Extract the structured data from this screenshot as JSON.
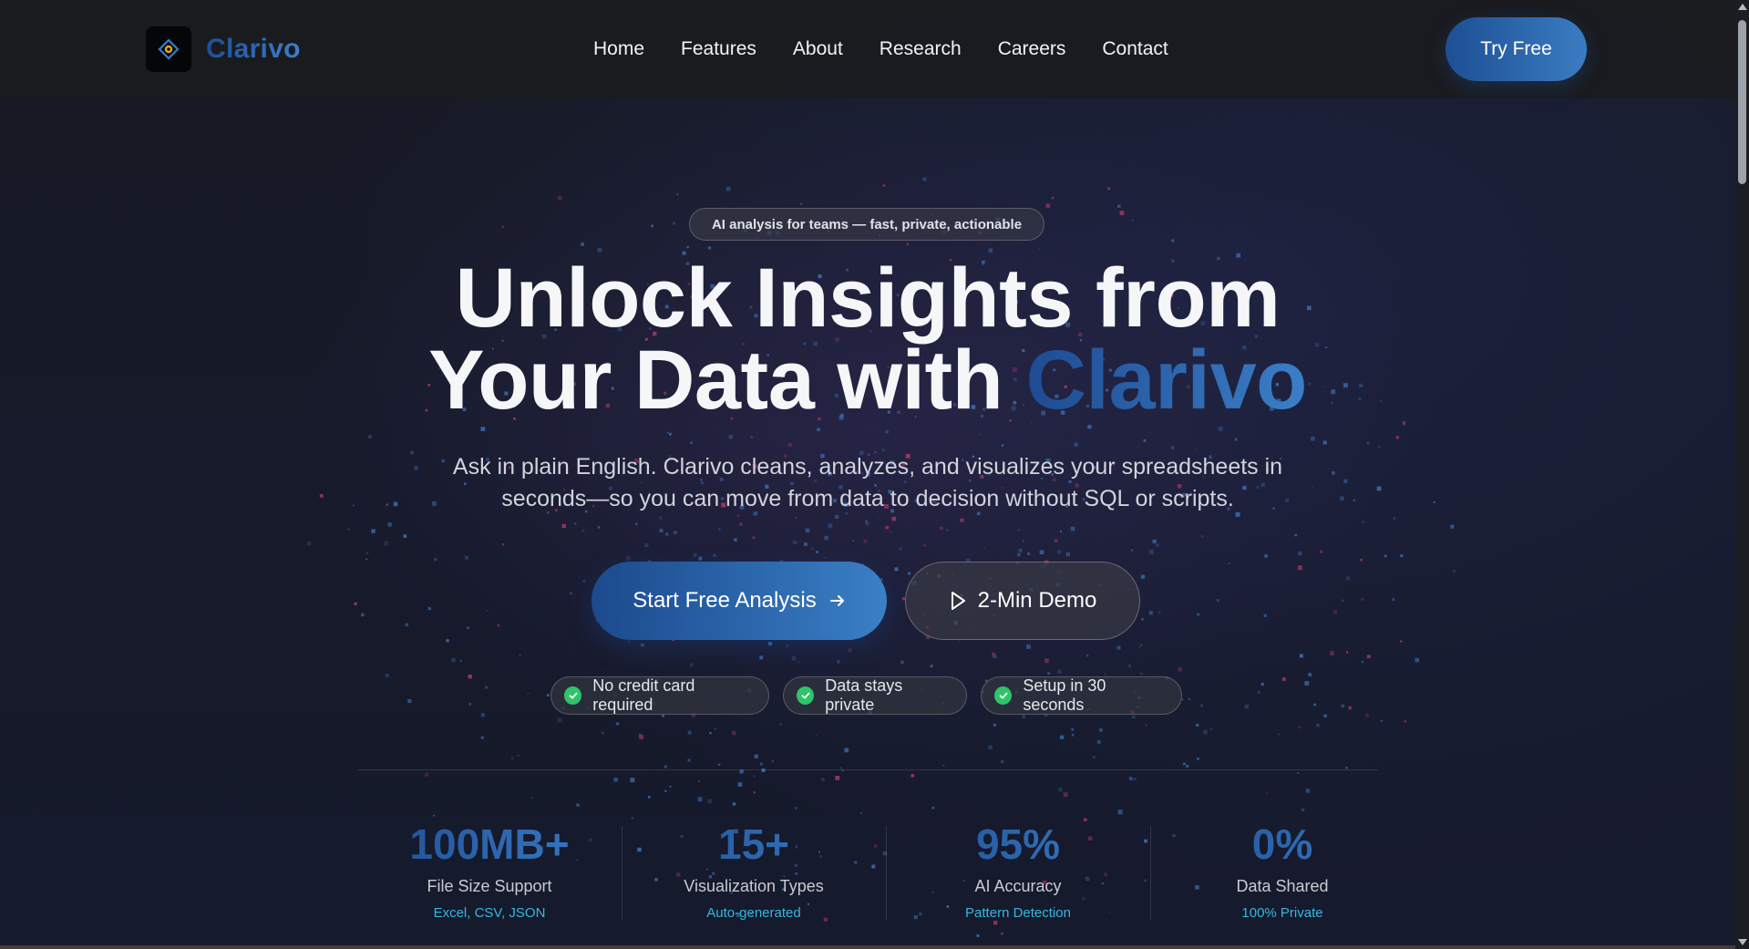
{
  "brand": {
    "name": "Clarivo",
    "logo_icon": "eye-diamond-icon",
    "accent_gradient": [
      "#1e4b92",
      "#3b7fc8"
    ]
  },
  "nav": {
    "links": [
      "Home",
      "Features",
      "About",
      "Research",
      "Careers",
      "Contact"
    ],
    "cta_label": "Try Free"
  },
  "hero": {
    "badge": "AI analysis for teams — fast, private, actionable",
    "headline_line1": "Unlock Insights from",
    "headline_line2_prefix": "Your Data with ",
    "headline_accent": "Clarivo",
    "subtext": "Ask in plain English. Clarivo cleans, analyzes, and visualizes your spreadsheets in seconds—so you can move from data to decision without SQL or scripts.",
    "primary_cta": "Start Free Analysis",
    "primary_cta_icon": "arrow-right-icon",
    "secondary_cta": "2-Min Demo",
    "secondary_cta_icon": "play-icon",
    "trust_badges": [
      "No credit card required",
      "Data stays private",
      "Setup in 30 seconds"
    ],
    "trust_icon": "check-circle-icon",
    "check_color": "#2fc36a"
  },
  "stats": [
    {
      "value": "100MB+",
      "label": "File Size Support",
      "sub": "Excel, CSV, JSON"
    },
    {
      "value": "15+",
      "label": "Visualization Types",
      "sub": "Auto-generated"
    },
    {
      "value": "95%",
      "label": "AI Accuracy",
      "sub": "Pattern Detection"
    },
    {
      "value": "0%",
      "label": "Data Shared",
      "sub": "100% Private"
    }
  ],
  "colors": {
    "background": "#151a2c",
    "nav_background": "#1a1b1f",
    "stat_sub": "#35b8e0",
    "particle_blue": "#3a72b8",
    "particle_pink": "#b03a6a"
  }
}
